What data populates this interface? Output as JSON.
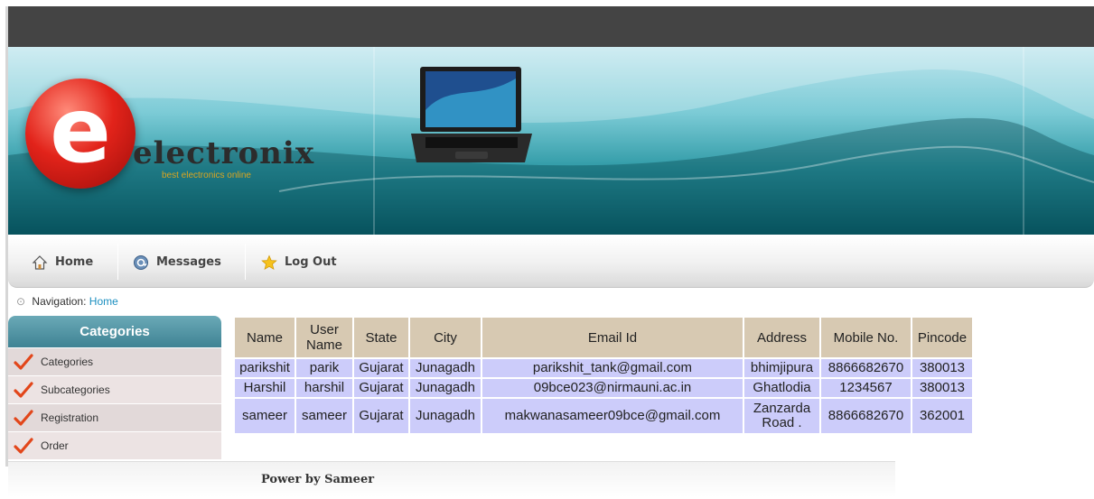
{
  "brand": {
    "logo_letter": "e",
    "name": "electronix",
    "tagline": "best electronics online"
  },
  "nav": {
    "items": [
      {
        "label": "Home",
        "icon": "home-icon"
      },
      {
        "label": "Messages",
        "icon": "messages-icon"
      },
      {
        "label": "Log Out",
        "icon": "star-icon"
      }
    ]
  },
  "breadcrumb": {
    "label": "Navigation:",
    "current": "Home"
  },
  "sidebar": {
    "title": "Categories",
    "items": [
      {
        "label": "Categories",
        "icon": "checkmark-icon"
      },
      {
        "label": "Subcategories",
        "icon": "checkmark-icon"
      },
      {
        "label": "Registration",
        "icon": "checkmark-icon"
      },
      {
        "label": "Order",
        "icon": "checkmark-icon"
      }
    ]
  },
  "table": {
    "columns": [
      "Name",
      "User Name",
      "State",
      "City",
      "Email Id",
      "Address",
      "Mobile No.",
      "Pincode"
    ],
    "rows": [
      [
        "parikshit",
        "parik",
        "Gujarat",
        "Junagadh",
        "parikshit_tank@gmail.com",
        "bhimjipura",
        "8866682670",
        "380013"
      ],
      [
        "Harshil",
        "harshil",
        "Gujarat",
        "Junagadh",
        "09bce023@nirmauni.ac.in",
        "Ghatlodia",
        "1234567",
        "380013"
      ],
      [
        "sameer",
        "sameer",
        "Gujarat",
        "Junagadh",
        "makwanasameer09bce@gmail.com",
        "Zanzarda Road .",
        "8866682670",
        "362001"
      ]
    ]
  },
  "footer": {
    "text": "Power by Sameer"
  },
  "colors": {
    "topbar": "#444444",
    "header_cell": "#d7c9b2",
    "body_cell": "#ccccfa",
    "link": "#1b8fc0",
    "checkmark": "#e2461a"
  }
}
